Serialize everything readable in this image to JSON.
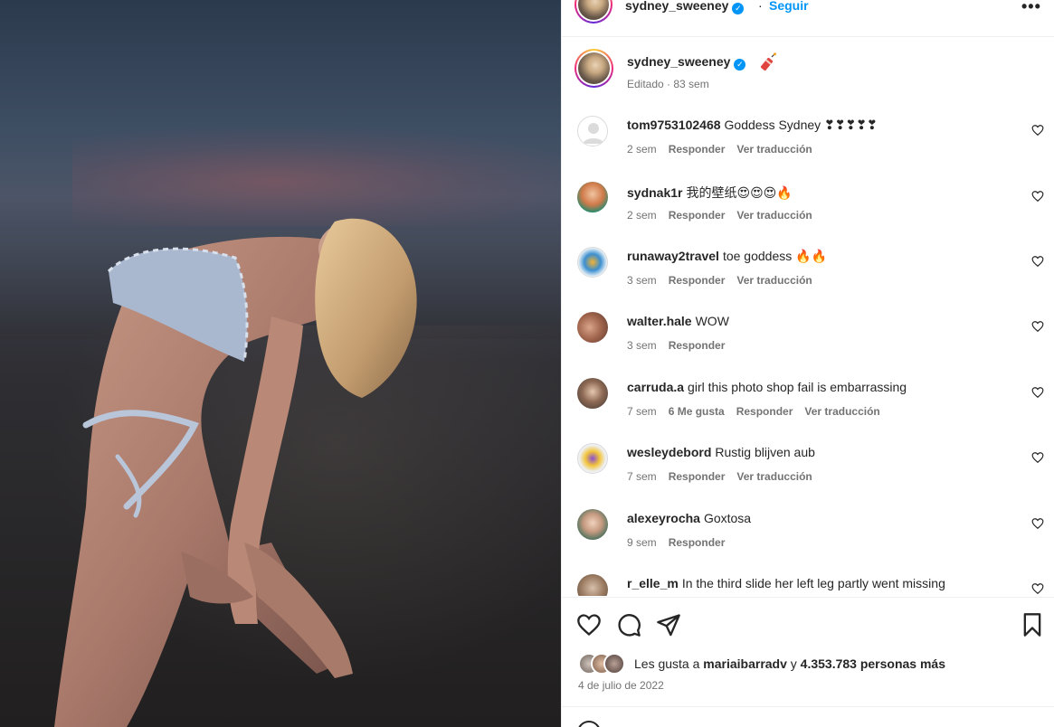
{
  "post": {
    "username": "sydney_sweeney",
    "follow_label": "Seguir",
    "dot": "·",
    "verified_glyph": "✓",
    "more_glyph": "•••"
  },
  "caption": {
    "username": "sydney_sweeney",
    "meta": "Editado · 83 sem"
  },
  "comments": [
    {
      "user": "tom9753102468",
      "text": "Goddess Sydney ❣❣❣❣❣",
      "age": "2 sem",
      "likes": "",
      "reply": "Responder",
      "translate": "Ver traducción"
    },
    {
      "user": "sydnak1r",
      "text": "我的壁纸😍😍😍🔥",
      "age": "2 sem",
      "likes": "",
      "reply": "Responder",
      "translate": "Ver traducción"
    },
    {
      "user": "runaway2travel",
      "text": "toe goddess 🔥🔥",
      "age": "3 sem",
      "likes": "",
      "reply": "Responder",
      "translate": "Ver traducción"
    },
    {
      "user": "walter.hale",
      "text": "WOW",
      "age": "3 sem",
      "likes": "",
      "reply": "Responder",
      "translate": ""
    },
    {
      "user": "carruda.a",
      "text": "girl this photo shop fail is embarrassing",
      "age": "7 sem",
      "likes": "6 Me gusta",
      "reply": "Responder",
      "translate": "Ver traducción"
    },
    {
      "user": "wesleydebord",
      "text": "Rustig blijven aub",
      "age": "7 sem",
      "likes": "",
      "reply": "Responder",
      "translate": "Ver traducción"
    },
    {
      "user": "alexeyrocha",
      "text": "Goxtosa",
      "age": "9 sem",
      "likes": "",
      "reply": "Responder",
      "translate": ""
    },
    {
      "user": "r_elle_m",
      "text": "In the third slide her left leg partly went missing",
      "age": "",
      "likes": "",
      "reply": "",
      "translate": ""
    }
  ],
  "likes": {
    "prefix": "Les gusta a",
    "user": "mariaibarradv",
    "conj": "y",
    "count": "4.353.783 personas más"
  },
  "date": "4 de julio de 2022",
  "icons": [
    "heart-icon",
    "comment-icon",
    "share-icon",
    "bookmark-icon",
    "more-icon",
    "verified-icon",
    "emoji-icon"
  ],
  "colors": {
    "accent": "#0095f6",
    "muted": "#737373",
    "text": "#262626"
  }
}
